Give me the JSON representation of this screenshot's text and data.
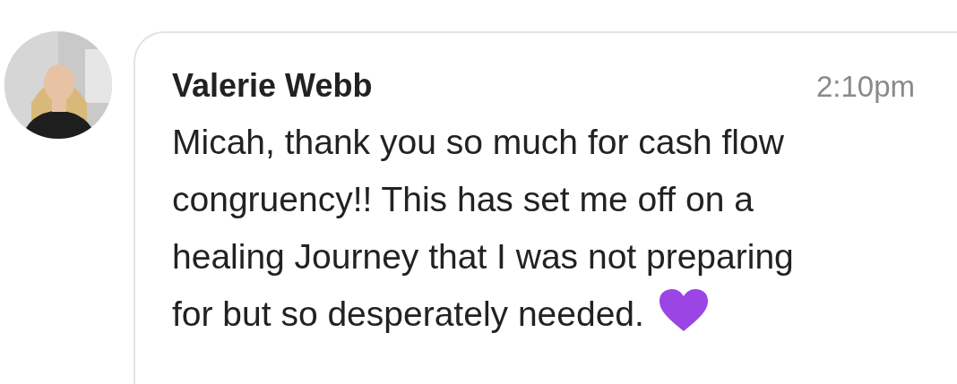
{
  "comment": {
    "author": "Valerie Webb",
    "time": "2:10pm",
    "message_lines": [
      "Micah, thank you so much for cash flow",
      "congruency!! This has set me off on a",
      "healing Journey that I was not preparing",
      "for but so desperately needed."
    ]
  }
}
